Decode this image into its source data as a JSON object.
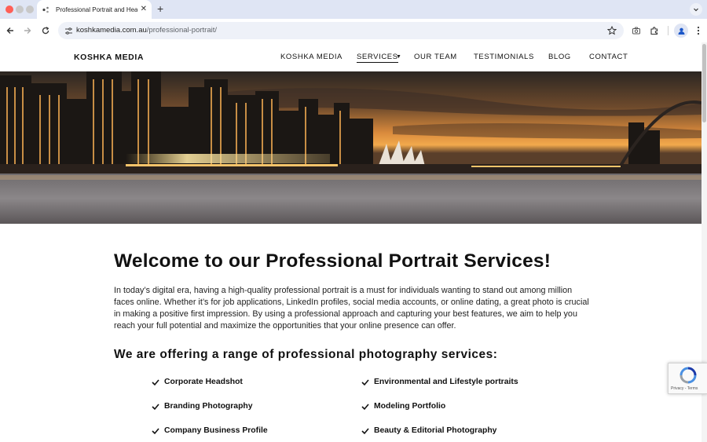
{
  "browser": {
    "tab_title": "Professional Portrait and Hea",
    "url_host": "koshkamedia.com.au",
    "url_path": "/professional-portrait/",
    "new_tab_symbol": "+",
    "tab_close_symbol": "✕"
  },
  "site": {
    "logo": "KOSHKA MEDIA",
    "nav": [
      {
        "label": "KOSHKA MEDIA",
        "active": false
      },
      {
        "label": "SERVICES",
        "active": true,
        "has_dropdown": true
      },
      {
        "label": "OUR TEAM",
        "active": false
      },
      {
        "label": "TESTIMONIALS",
        "active": false
      },
      {
        "label": "BLOG",
        "active": false
      },
      {
        "label": "CONTACT",
        "active": false
      }
    ],
    "hero_image": "sydney-harbour-night-skyline"
  },
  "main": {
    "title": "Welcome to our Professional Portrait Services!",
    "intro": "In today’s digital era, having a high-quality professional portrait is a must for individuals wanting to stand out among million faces online. Whether it’s for job applications, LinkedIn profiles, social media accounts, or online dating, a great photo is crucial in making a positive first impression. By using a professional approach and capturing your best features, we aim to help you reach your full potential and maximize the opportunities that your online presence can offer.",
    "services_heading": "We are offering a range of professional photography services:",
    "services_left": [
      "Corporate Headshot",
      "Branding Photography",
      "Company Business Profile"
    ],
    "services_right": [
      "Environmental and Lifestyle portraits",
      "Modeling Portfolio",
      "Beauty & Editorial Photography"
    ]
  },
  "recaptcha": {
    "text": "Privacy - Terms"
  },
  "colors": {
    "chrome_bg": "#dfe5f4",
    "omnibox_bg": "#eef1f8",
    "text": "#111111",
    "recaptcha_blue": "#1c3aa9"
  }
}
